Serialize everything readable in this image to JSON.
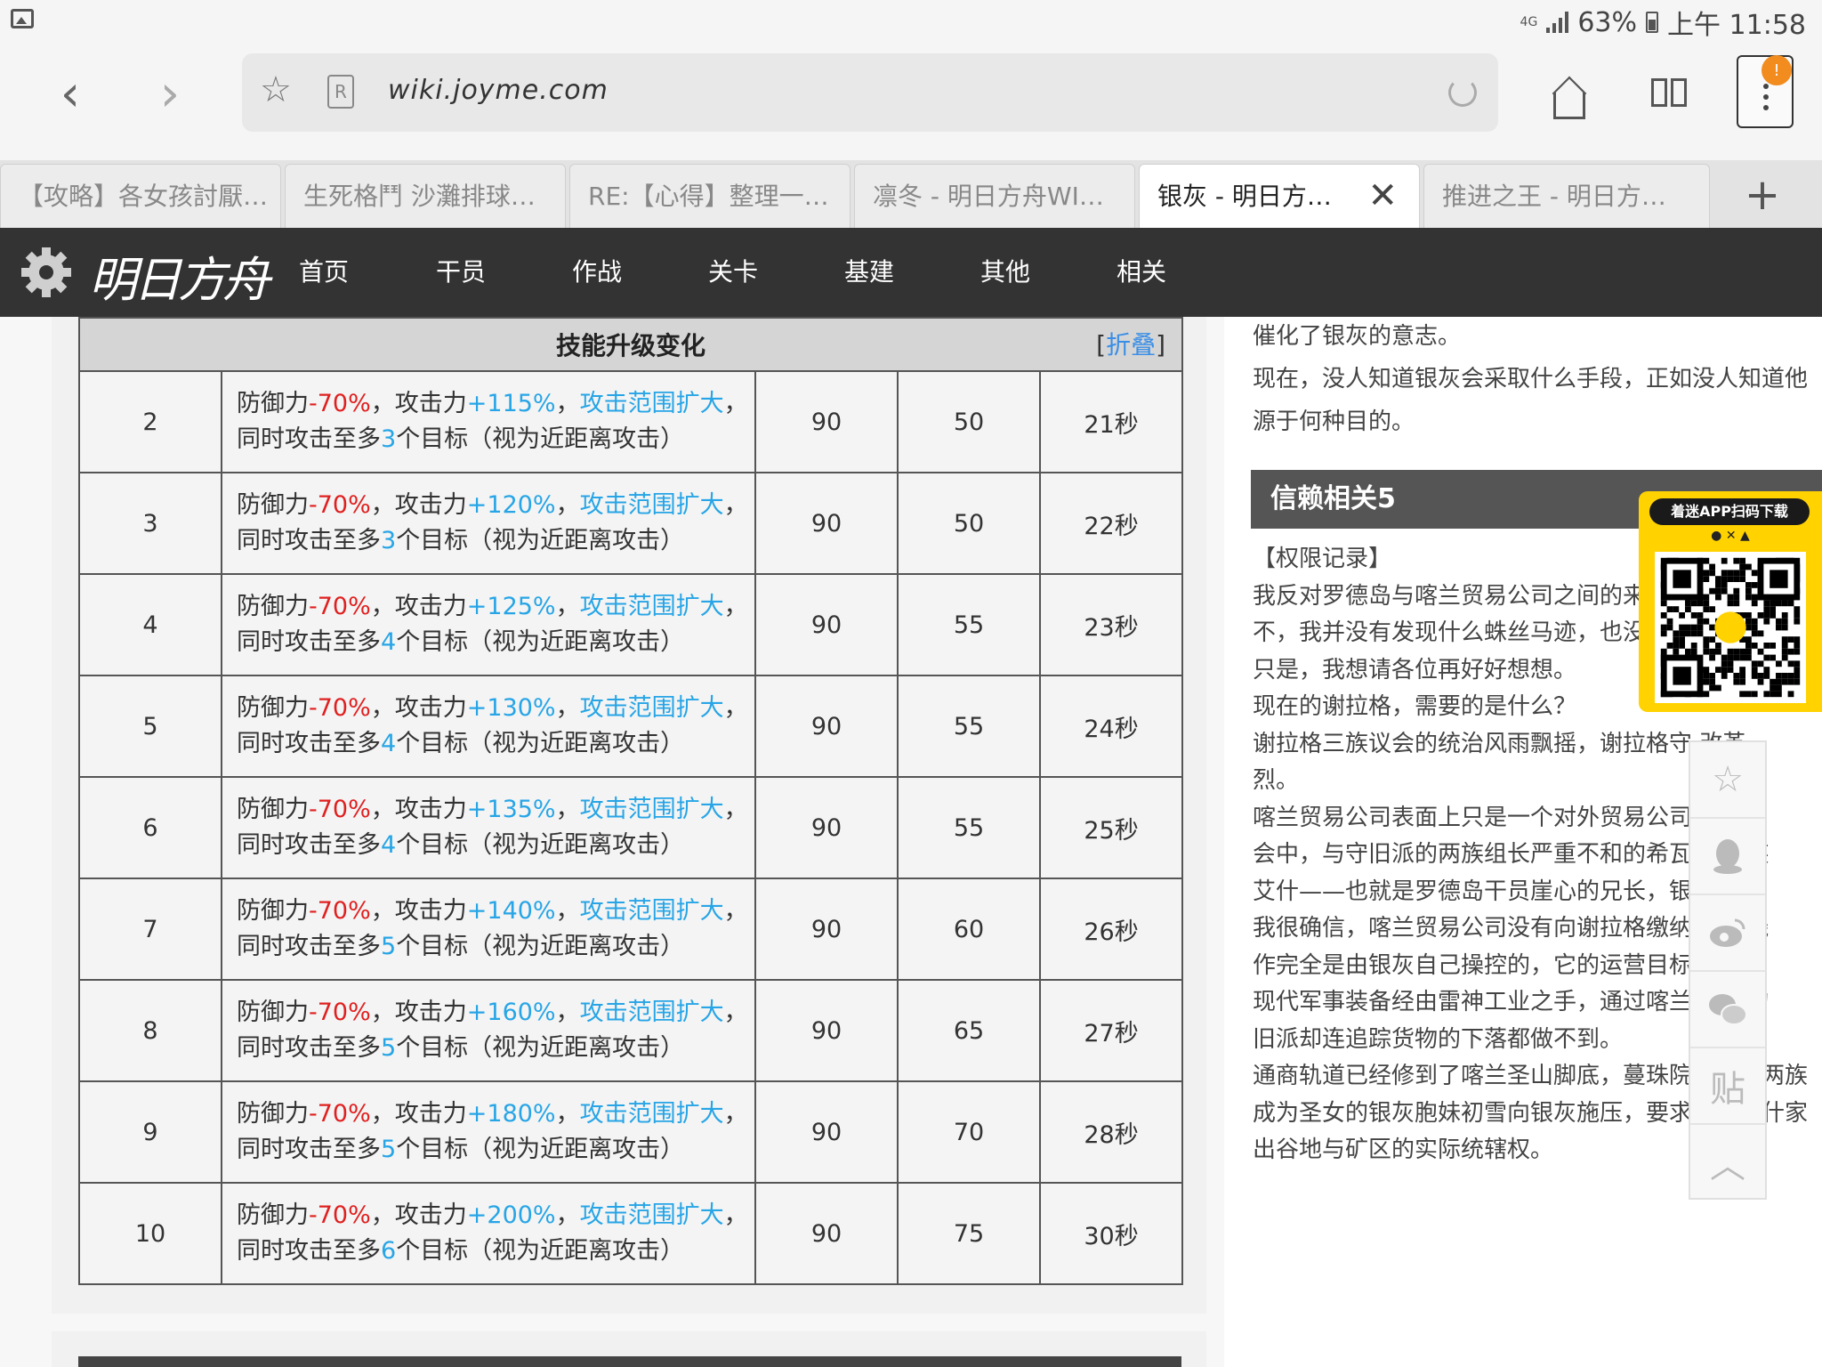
{
  "status": {
    "network": "4G",
    "battery": "63%",
    "time": "上午 11:58"
  },
  "browser": {
    "url": "wiki.joyme.com",
    "menu_badge": "!",
    "tabs": [
      {
        "label": "【攻略】各女孩討厭…"
      },
      {
        "label": "生死格鬥 沙灘排球…"
      },
      {
        "label": "RE:【心得】整理一…"
      },
      {
        "label": "凛冬 - 明日方舟WI…"
      },
      {
        "label": "银灰 - 明日方…"
      },
      {
        "label": "推进之王 - 明日方…"
      }
    ],
    "active_tab": 4,
    "new_tab": "+"
  },
  "site": {
    "logo": "明日方舟",
    "nav": [
      "首页",
      "干员",
      "作战",
      "关卡",
      "基建",
      "其他",
      "相关"
    ]
  },
  "skill_table": {
    "title": "技能升级变化",
    "fold_prefix": "[",
    "fold_label": "折叠",
    "fold_suffix": "]",
    "rows": [
      {
        "level": "2",
        "def": "-70%",
        "atk": "+115%",
        "targets": "3",
        "c1": "90",
        "c2": "50",
        "dur": "21秒"
      },
      {
        "level": "3",
        "def": "-70%",
        "atk": "+120%",
        "targets": "3",
        "c1": "90",
        "c2": "50",
        "dur": "22秒"
      },
      {
        "level": "4",
        "def": "-70%",
        "atk": "+125%",
        "targets": "4",
        "c1": "90",
        "c2": "55",
        "dur": "23秒"
      },
      {
        "level": "5",
        "def": "-70%",
        "atk": "+130%",
        "targets": "4",
        "c1": "90",
        "c2": "55",
        "dur": "24秒"
      },
      {
        "level": "6",
        "def": "-70%",
        "atk": "+135%",
        "targets": "4",
        "c1": "90",
        "c2": "55",
        "dur": "25秒"
      },
      {
        "level": "7",
        "def": "-70%",
        "atk": "+140%",
        "targets": "5",
        "c1": "90",
        "c2": "60",
        "dur": "26秒"
      },
      {
        "level": "8",
        "def": "-70%",
        "atk": "+160%",
        "targets": "5",
        "c1": "90",
        "c2": "65",
        "dur": "27秒"
      },
      {
        "level": "9",
        "def": "-70%",
        "atk": "+180%",
        "targets": "5",
        "c1": "90",
        "c2": "70",
        "dur": "28秒"
      },
      {
        "level": "10",
        "def": "-70%",
        "atk": "+200%",
        "targets": "6",
        "c1": "90",
        "c2": "75",
        "dur": "30秒"
      }
    ],
    "text": {
      "def_label": "防御力",
      "atk_label": "，攻击力",
      "comma": "，",
      "range": "攻击范围扩大",
      "range_tail": "，",
      "line2_pre": "同时攻击至多",
      "line2_post": "个目标（视为近距离攻击）"
    }
  },
  "right_panel": {
    "lines_top": [
      "催化了银灰的意志。",
      "现在，没人知道银灰会采取什么手段，正如没人知道他",
      "源于何种目的。"
    ],
    "section_title": "信赖相关5",
    "lines": [
      "【权限记录】",
      "我反对罗德岛与喀兰贸易公司之间的来",
      "不，我并没有发现什么蛛丝马迹，也没",
      "只是，我想请各位再好好想想。",
      "现在的谢拉格，需要的是什么？",
      "谢拉格三族议会的统治风雨飘摇，谢拉格守                    改革",
      "烈。",
      "喀兰贸易公司表面上只是一个对外贸易公司                  的真",
      "会中，与守旧派的两族组长严重不和的希瓦                  家族族",
      "艾什——也就是罗德岛干员崖心的兄长，银",
      "我很确信，喀兰贸易公司没有向谢拉格缴纳                  一分钱",
      "作完全是由银灰自己操控的，它的运营目标                  也是。",
      "现代军事装备经由雷神工业之手，通过喀兰                  公司的",
      "旧派却连追踪货物的下落都做不到。",
      "通商轨道已经修到了喀兰圣山脚底，蔓珠院在其他两族",
      "成为圣女的银灰胞妹初雪向银灰施压，要求希瓦艾什家",
      "出谷地与矿区的实际统辖权。"
    ]
  },
  "qr": {
    "title": "着迷APP扫码下载",
    "os": " ✕ "
  },
  "share": {
    "tieba": "贴"
  }
}
